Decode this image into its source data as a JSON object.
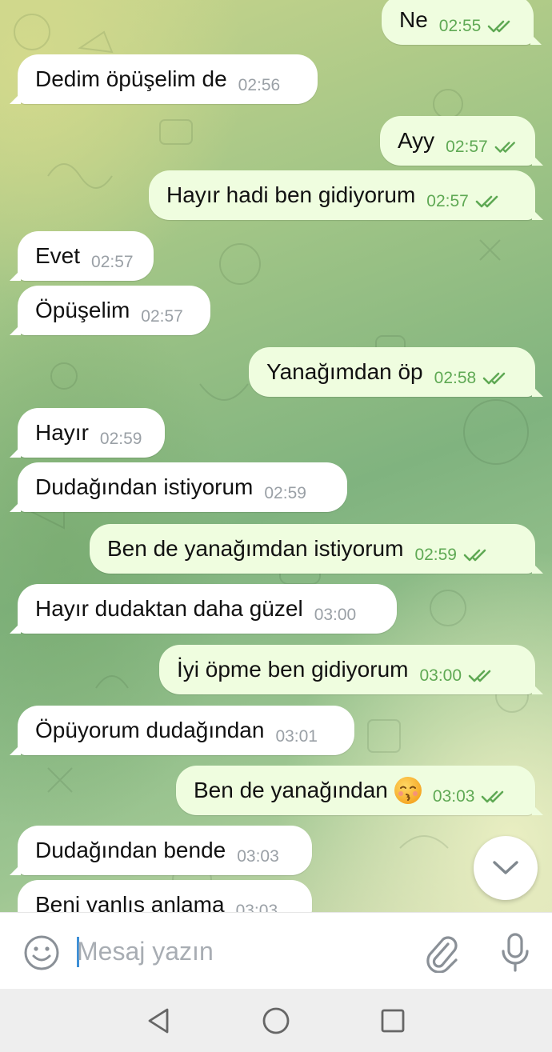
{
  "messages": [
    {
      "side": "out",
      "text": "Ne",
      "time": "02:55",
      "read": true
    },
    {
      "side": "in",
      "text": "Dedim öpüşelim de",
      "time": "02:56"
    },
    {
      "side": "out",
      "text": "Ayy",
      "time": "02:57",
      "read": true
    },
    {
      "side": "out",
      "text": "Hayır hadi ben gidiyorum",
      "time": "02:57",
      "read": true
    },
    {
      "side": "in",
      "text": "Evet",
      "time": "02:57"
    },
    {
      "side": "in",
      "text": "Öpüşelim",
      "time": "02:57"
    },
    {
      "side": "out",
      "text": "Yanağımdan öp",
      "time": "02:58",
      "read": true
    },
    {
      "side": "in",
      "text": "Hayır",
      "time": "02:59"
    },
    {
      "side": "in",
      "text": "Dudağından istiyorum",
      "time": "02:59"
    },
    {
      "side": "out",
      "text": "Ben de yanağımdan istiyorum",
      "time": "02:59",
      "read": true
    },
    {
      "side": "in",
      "text": "Hayır dudaktan daha güzel",
      "time": "03:00"
    },
    {
      "side": "out",
      "text": "İyi öpme ben gidiyorum",
      "time": "03:00",
      "read": true
    },
    {
      "side": "in",
      "text": "Öpüyorum dudağından",
      "time": "03:01"
    },
    {
      "side": "out",
      "text": "Ben de yanağından",
      "time": "03:03",
      "read": true,
      "emoji": "kissing-face-closed-eyes"
    },
    {
      "side": "in",
      "text": "Dudağından bende",
      "time": "03:03"
    },
    {
      "side": "in",
      "text": "Beni yanlış anlama",
      "time": "03:03"
    }
  ],
  "composer": {
    "placeholder": "Mesaj yazın",
    "icons": [
      "emoji-icon",
      "attach-icon",
      "microphone-icon"
    ]
  },
  "nav_icons": [
    "back-icon",
    "home-icon",
    "recents-icon"
  ],
  "colors": {
    "incoming_bubble": "#ffffff",
    "outgoing_bubble": "#effddf",
    "outgoing_time": "#5fa954",
    "incoming_time": "#9aa0a6",
    "caret": "#3d8fd6"
  }
}
